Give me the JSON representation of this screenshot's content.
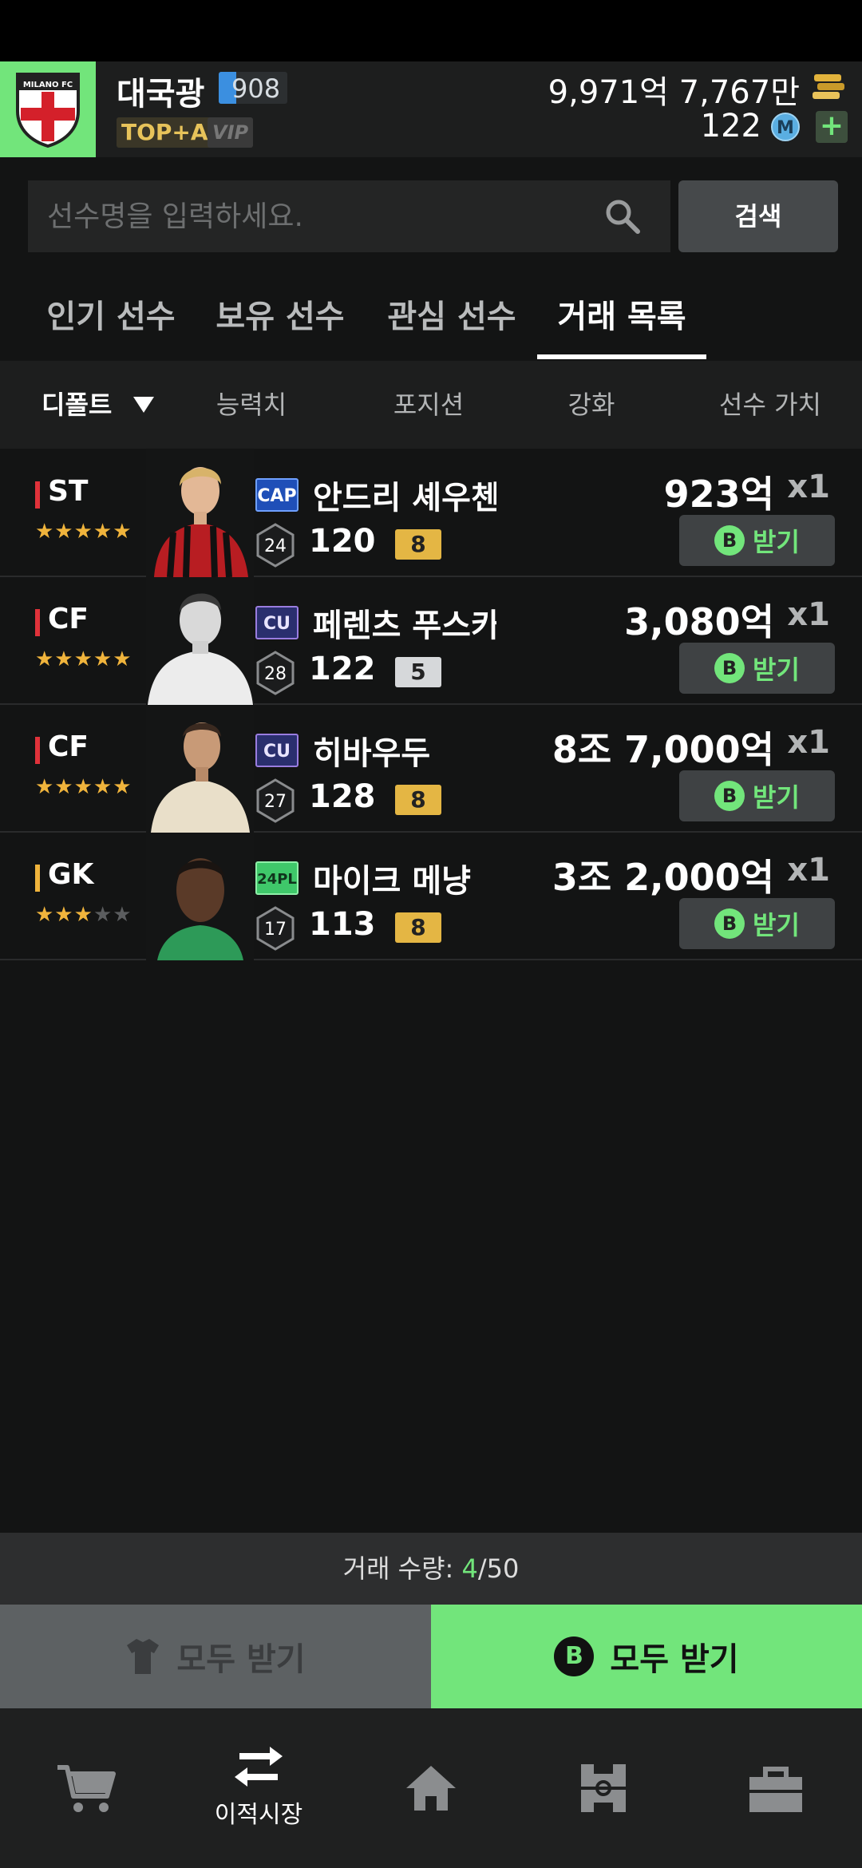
{
  "header": {
    "club_name": "MILANO FC",
    "username": "대국광",
    "level": "908",
    "rank": "TOP+A",
    "vip": "VIP",
    "bp_amount": "9,971억 7,767만",
    "m_amount": "122",
    "m_icon_label": "M",
    "plus_label": "+"
  },
  "search": {
    "placeholder": "선수명을 입력하세요.",
    "button_label": "검색"
  },
  "tabs": [
    {
      "label": "인기 선수",
      "active": false
    },
    {
      "label": "보유 선수",
      "active": false
    },
    {
      "label": "관심 선수",
      "active": false
    },
    {
      "label": "거래 목록",
      "active": true
    }
  ],
  "sort": {
    "default_label": "디폴트",
    "options": [
      "능력치",
      "포지션",
      "강화",
      "선수 가치"
    ]
  },
  "trades": [
    {
      "position": "ST",
      "pos_color": "#e0323a",
      "stars": 5,
      "season": "CAP",
      "name": "안드리 셰우첸",
      "age": "24",
      "ovr": "120",
      "grade": "8",
      "price": "923억",
      "qty": "x1",
      "button": "받기"
    },
    {
      "position": "CF",
      "pos_color": "#e0323a",
      "stars": 5,
      "season": "CU",
      "name": "페렌츠 푸스카",
      "age": "28",
      "ovr": "122",
      "grade": "5",
      "price": "3,080억",
      "qty": "x1",
      "button": "받기"
    },
    {
      "position": "CF",
      "pos_color": "#e0323a",
      "stars": 5,
      "season": "CU",
      "name": "히바우두",
      "age": "27",
      "ovr": "128",
      "grade": "8",
      "price": "8조 7,000억",
      "qty": "x1",
      "button": "받기"
    },
    {
      "position": "GK",
      "pos_color": "#f0b43c",
      "stars": 3,
      "season": "24PL",
      "name": "마이크 메냥",
      "age": "17",
      "ovr": "113",
      "grade": "8",
      "price": "3조 2,000억",
      "qty": "x1",
      "button": "받기"
    }
  ],
  "trade_count": {
    "label": "거래 수량: ",
    "current": "4",
    "max": "/50"
  },
  "actions": {
    "receive_all_gray": "모두 받기",
    "receive_all_green": "모두 받기",
    "coin_letter": "B"
  },
  "bottom_nav": [
    {
      "icon": "cart-icon",
      "label": ""
    },
    {
      "icon": "transfer-icon",
      "label": "이적시장"
    },
    {
      "icon": "home-icon",
      "label": ""
    },
    {
      "icon": "field-icon",
      "label": ""
    },
    {
      "icon": "bag-icon",
      "label": ""
    }
  ]
}
